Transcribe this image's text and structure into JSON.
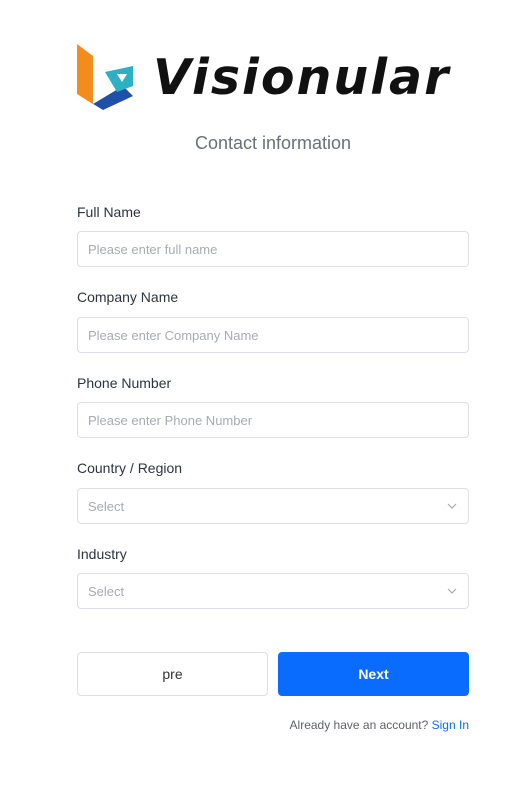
{
  "brand": {
    "name": "Visionular",
    "colors": {
      "orange": "#f28c1c",
      "blue": "#1f4fa8",
      "teal": "#2bb0c6",
      "accent": "#0a6cff"
    }
  },
  "header": {
    "subtitle": "Contact information"
  },
  "form": {
    "full_name": {
      "label": "Full Name",
      "placeholder": "Please enter full name",
      "value": ""
    },
    "company_name": {
      "label": "Company Name",
      "placeholder": "Please enter Company Name",
      "value": ""
    },
    "phone_number": {
      "label": "Phone Number",
      "placeholder": "Please enter Phone Number",
      "value": ""
    },
    "country_region": {
      "label": "Country / Region",
      "selected": "Select",
      "icon": "chevron-down-icon"
    },
    "industry": {
      "label": "Industry",
      "selected": "Select",
      "icon": "chevron-down-icon"
    }
  },
  "actions": {
    "pre_label": "pre",
    "next_label": "Next"
  },
  "footer": {
    "prompt": "Already have an account?",
    "link": "Sign In"
  }
}
